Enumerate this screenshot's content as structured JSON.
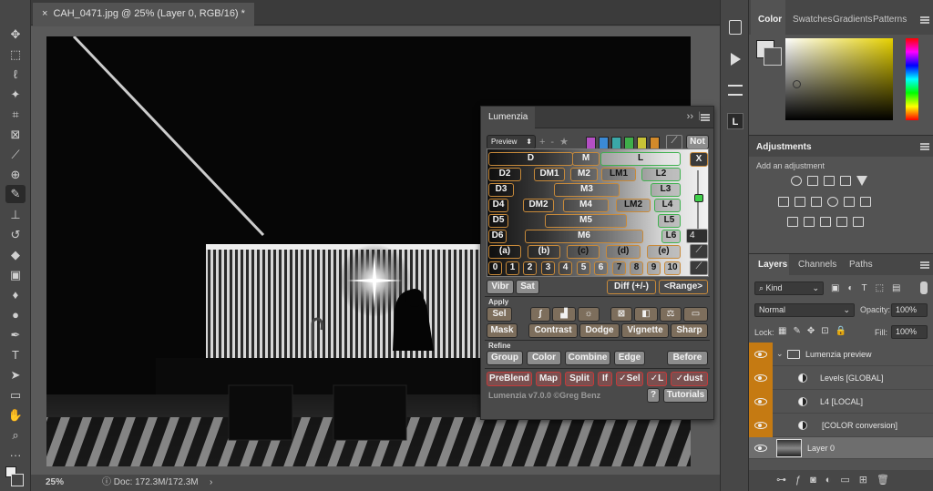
{
  "document": {
    "tab_title": "CAH_0471.jpg @ 25% (Layer 0, RGB/16) *",
    "zoom": "25%",
    "doc_size": "Doc: 172.3M/172.3M"
  },
  "tools": [
    "move",
    "marquee",
    "lasso",
    "magic-wand",
    "crop",
    "frame",
    "eyedropper",
    "healing",
    "brush",
    "stamp",
    "history-brush",
    "eraser",
    "gradient",
    "blur",
    "dodge",
    "pen",
    "type",
    "path-select",
    "rectangle",
    "hand",
    "zoom",
    "more"
  ],
  "right_strip": {
    "l_label": "L"
  },
  "color_panel": {
    "tabs": [
      "Color",
      "Swatches",
      "Gradients",
      "Patterns"
    ],
    "foreground": "#e0e0e0",
    "background": "#555555"
  },
  "adjustments": {
    "title": "Adjustments",
    "hint": "Add an adjustment"
  },
  "layers_panel": {
    "tabs": [
      "Layers",
      "Channels",
      "Paths"
    ],
    "kind": "Kind",
    "blend_mode": "Normal",
    "opacity_label": "Opacity:",
    "opacity": "100%",
    "lock_label": "Lock:",
    "fill_label": "Fill:",
    "fill": "100%",
    "layers": [
      {
        "name": "Lumenzia preview",
        "type": "group"
      },
      {
        "name": "Levels [GLOBAL]",
        "type": "adjustment"
      },
      {
        "name": "L4 [LOCAL]",
        "type": "adjustment"
      },
      {
        "name": "[COLOR conversion]",
        "type": "adjustment"
      },
      {
        "name": "Layer 0",
        "type": "pixel"
      }
    ]
  },
  "lumenzia": {
    "tab": "Lumenzia",
    "preview": "Preview",
    "not_label": "Not",
    "x_label": "X",
    "num_value": "4",
    "zones": {
      "D": "D",
      "M": "M",
      "L": "L",
      "D2": "D2",
      "DM1": "DM1",
      "M2": "M2",
      "LM1": "LM1",
      "L2": "L2",
      "D3": "D3",
      "M3": "M3",
      "L3": "L3",
      "D4": "D4",
      "DM2": "DM2",
      "M4": "M4",
      "LM2": "LM2",
      "L4": "L4",
      "D5": "D5",
      "M5": "M5",
      "L5": "L5",
      "D6": "D6",
      "M6": "M6",
      "L6": "L6"
    },
    "letters": [
      "(a)",
      "(b)",
      "(c)",
      "(d)",
      "(e)"
    ],
    "numbers": [
      "0",
      "1",
      "2",
      "3",
      "4",
      "5",
      "6",
      "7",
      "8",
      "9",
      "10"
    ],
    "vibr": "Vibr",
    "sat": "Sat",
    "diff": "Diff (+/-)",
    "range": "<Range>",
    "apply_label": "Apply",
    "sel": "Sel",
    "mask": "Mask",
    "contrast": "Contrast",
    "dodge": "Dodge",
    "vignette": "Vignette",
    "sharp": "Sharp",
    "refine_label": "Refine",
    "group": "Group",
    "color": "Color",
    "combine": "Combine",
    "edge": "Edge",
    "before": "Before",
    "preblend": "PreBlend",
    "map": "Map",
    "split": "Split",
    "if": "If",
    "vsel": "✓Sel",
    "vl": "✓L",
    "vdust": "✓dust",
    "version": "Lumenzia v7.0.0 ©Greg Benz",
    "help": "?",
    "tutorials": "Tutorials",
    "swatch_colors": [
      "#b44fc4",
      "#3b8ad6",
      "#3aa8a8",
      "#3fae4a",
      "#c8c236",
      "#d28a2a",
      "#c23a3a"
    ]
  }
}
